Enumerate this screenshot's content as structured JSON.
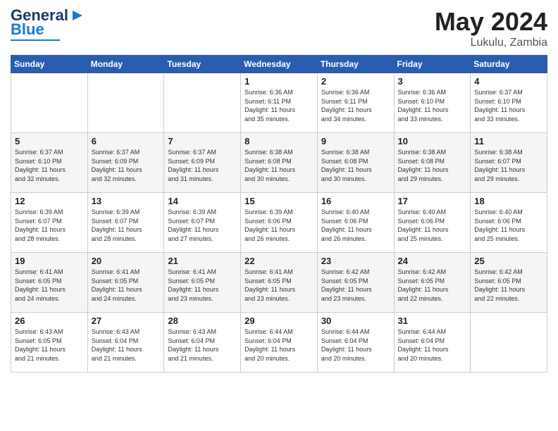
{
  "logo": {
    "line1": "General",
    "line2": "Blue"
  },
  "header": {
    "month": "May 2024",
    "location": "Lukulu, Zambia"
  },
  "weekdays": [
    "Sunday",
    "Monday",
    "Tuesday",
    "Wednesday",
    "Thursday",
    "Friday",
    "Saturday"
  ],
  "weeks": [
    [
      {
        "day": "",
        "info": ""
      },
      {
        "day": "",
        "info": ""
      },
      {
        "day": "",
        "info": ""
      },
      {
        "day": "1",
        "info": "Sunrise: 6:36 AM\nSunset: 6:11 PM\nDaylight: 11 hours\nand 35 minutes."
      },
      {
        "day": "2",
        "info": "Sunrise: 6:36 AM\nSunset: 6:11 PM\nDaylight: 11 hours\nand 34 minutes."
      },
      {
        "day": "3",
        "info": "Sunrise: 6:36 AM\nSunset: 6:10 PM\nDaylight: 11 hours\nand 33 minutes."
      },
      {
        "day": "4",
        "info": "Sunrise: 6:37 AM\nSunset: 6:10 PM\nDaylight: 11 hours\nand 33 minutes."
      }
    ],
    [
      {
        "day": "5",
        "info": "Sunrise: 6:37 AM\nSunset: 6:10 PM\nDaylight: 11 hours\nand 32 minutes."
      },
      {
        "day": "6",
        "info": "Sunrise: 6:37 AM\nSunset: 6:09 PM\nDaylight: 11 hours\nand 32 minutes."
      },
      {
        "day": "7",
        "info": "Sunrise: 6:37 AM\nSunset: 6:09 PM\nDaylight: 11 hours\nand 31 minutes."
      },
      {
        "day": "8",
        "info": "Sunrise: 6:38 AM\nSunset: 6:08 PM\nDaylight: 11 hours\nand 30 minutes."
      },
      {
        "day": "9",
        "info": "Sunrise: 6:38 AM\nSunset: 6:08 PM\nDaylight: 11 hours\nand 30 minutes."
      },
      {
        "day": "10",
        "info": "Sunrise: 6:38 AM\nSunset: 6:08 PM\nDaylight: 11 hours\nand 29 minutes."
      },
      {
        "day": "11",
        "info": "Sunrise: 6:38 AM\nSunset: 6:07 PM\nDaylight: 11 hours\nand 29 minutes."
      }
    ],
    [
      {
        "day": "12",
        "info": "Sunrise: 6:39 AM\nSunset: 6:07 PM\nDaylight: 11 hours\nand 28 minutes."
      },
      {
        "day": "13",
        "info": "Sunrise: 6:39 AM\nSunset: 6:07 PM\nDaylight: 11 hours\nand 28 minutes."
      },
      {
        "day": "14",
        "info": "Sunrise: 6:39 AM\nSunset: 6:07 PM\nDaylight: 11 hours\nand 27 minutes."
      },
      {
        "day": "15",
        "info": "Sunrise: 6:39 AM\nSunset: 6:06 PM\nDaylight: 11 hours\nand 26 minutes."
      },
      {
        "day": "16",
        "info": "Sunrise: 6:40 AM\nSunset: 6:06 PM\nDaylight: 11 hours\nand 26 minutes."
      },
      {
        "day": "17",
        "info": "Sunrise: 6:40 AM\nSunset: 6:06 PM\nDaylight: 11 hours\nand 25 minutes."
      },
      {
        "day": "18",
        "info": "Sunrise: 6:40 AM\nSunset: 6:06 PM\nDaylight: 11 hours\nand 25 minutes."
      }
    ],
    [
      {
        "day": "19",
        "info": "Sunrise: 6:41 AM\nSunset: 6:05 PM\nDaylight: 11 hours\nand 24 minutes."
      },
      {
        "day": "20",
        "info": "Sunrise: 6:41 AM\nSunset: 6:05 PM\nDaylight: 11 hours\nand 24 minutes."
      },
      {
        "day": "21",
        "info": "Sunrise: 6:41 AM\nSunset: 6:05 PM\nDaylight: 11 hours\nand 23 minutes."
      },
      {
        "day": "22",
        "info": "Sunrise: 6:41 AM\nSunset: 6:05 PM\nDaylight: 11 hours\nand 23 minutes."
      },
      {
        "day": "23",
        "info": "Sunrise: 6:42 AM\nSunset: 6:05 PM\nDaylight: 11 hours\nand 23 minutes."
      },
      {
        "day": "24",
        "info": "Sunrise: 6:42 AM\nSunset: 6:05 PM\nDaylight: 11 hours\nand 22 minutes."
      },
      {
        "day": "25",
        "info": "Sunrise: 6:42 AM\nSunset: 6:05 PM\nDaylight: 11 hours\nand 22 minutes."
      }
    ],
    [
      {
        "day": "26",
        "info": "Sunrise: 6:43 AM\nSunset: 6:05 PM\nDaylight: 11 hours\nand 21 minutes."
      },
      {
        "day": "27",
        "info": "Sunrise: 6:43 AM\nSunset: 6:04 PM\nDaylight: 11 hours\nand 21 minutes."
      },
      {
        "day": "28",
        "info": "Sunrise: 6:43 AM\nSunset: 6:04 PM\nDaylight: 11 hours\nand 21 minutes."
      },
      {
        "day": "29",
        "info": "Sunrise: 6:44 AM\nSunset: 6:04 PM\nDaylight: 11 hours\nand 20 minutes."
      },
      {
        "day": "30",
        "info": "Sunrise: 6:44 AM\nSunset: 6:04 PM\nDaylight: 11 hours\nand 20 minutes."
      },
      {
        "day": "31",
        "info": "Sunrise: 6:44 AM\nSunset: 6:04 PM\nDaylight: 11 hours\nand 20 minutes."
      },
      {
        "day": "",
        "info": ""
      }
    ]
  ]
}
